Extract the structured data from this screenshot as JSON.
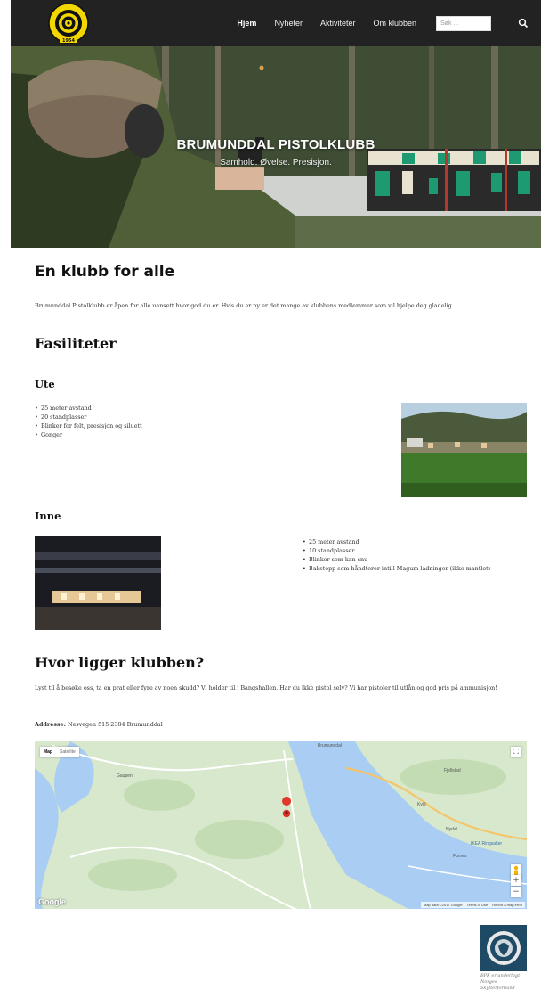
{
  "nav": {
    "items": [
      {
        "label": "Hjem",
        "active": true
      },
      {
        "label": "Nyheter",
        "active": false
      },
      {
        "label": "Aktiviteter",
        "active": false
      },
      {
        "label": "Om klubben",
        "active": false
      }
    ],
    "search_placeholder": "Søk ...",
    "logo_text": "BRUMUNDDAL PISTOLKLUBB",
    "logo_year": "1954"
  },
  "hero": {
    "title": "BRUMUNDDAL PISTOLKLUBB",
    "subtitle": "Samhold. Øvelse. Presisjon."
  },
  "intro": {
    "heading": "En klubb for alle",
    "text": "Brumunddal Pistolklubb er åpen for alle uansett hvor god du er. Hvis du er ny er det mange av klubbens medlemmer som vil hjelpe deg gladelig."
  },
  "facilities": {
    "heading": "Fasiliteter",
    "outdoor": {
      "heading": "Ute",
      "items": [
        "25 meter avstand",
        "20 standplasser",
        "Blinker for felt, presisjon og siluett",
        "Gonger"
      ]
    },
    "indoor": {
      "heading": "Inne",
      "items": [
        "25 meter avstand",
        "10 standplasser",
        "Blinker som kan snu",
        "Bakstopp som håndterer intill Magum ladninger (ikke mantlet)"
      ]
    }
  },
  "location": {
    "heading": "Hvor ligger klubben?",
    "text": "Lyst til å besøke oss, ta en prat eller fyre av noen skudd? Vi holder til i Bangshallen. Har du ikke pistol selv? Vi har pistoler til utlån og god pris på ammunisjon!",
    "address_label": "Addresse:",
    "address_value": "Nesvegen 515 2384 Brumunddal"
  },
  "map": {
    "type_map": "Map",
    "type_satellite": "Satellite",
    "labels": {
      "brumunddal": "Brumunddal",
      "gaupen": "Gaupen",
      "fjellstad": "Fjellstad",
      "kvitl": "Kvitl",
      "ikea": "IKEA Ringsaker",
      "furnes": "Furnes",
      "nydal": "Nydal"
    },
    "footer": [
      "Map data ©2017 Google",
      "Terms of Use",
      "Report a map error"
    ],
    "google": "Google",
    "zoom_in": "+",
    "zoom_out": "−"
  },
  "badge": {
    "caption_line1": "BPK er underlagt",
    "caption_line2": "Norges",
    "caption_line3": "Skytterforbund"
  },
  "colors": {
    "nav_bg": "#222222",
    "logo_yellow": "#f2d600",
    "water": "#a9cdf3",
    "badge_bg": "#1f4a66"
  }
}
